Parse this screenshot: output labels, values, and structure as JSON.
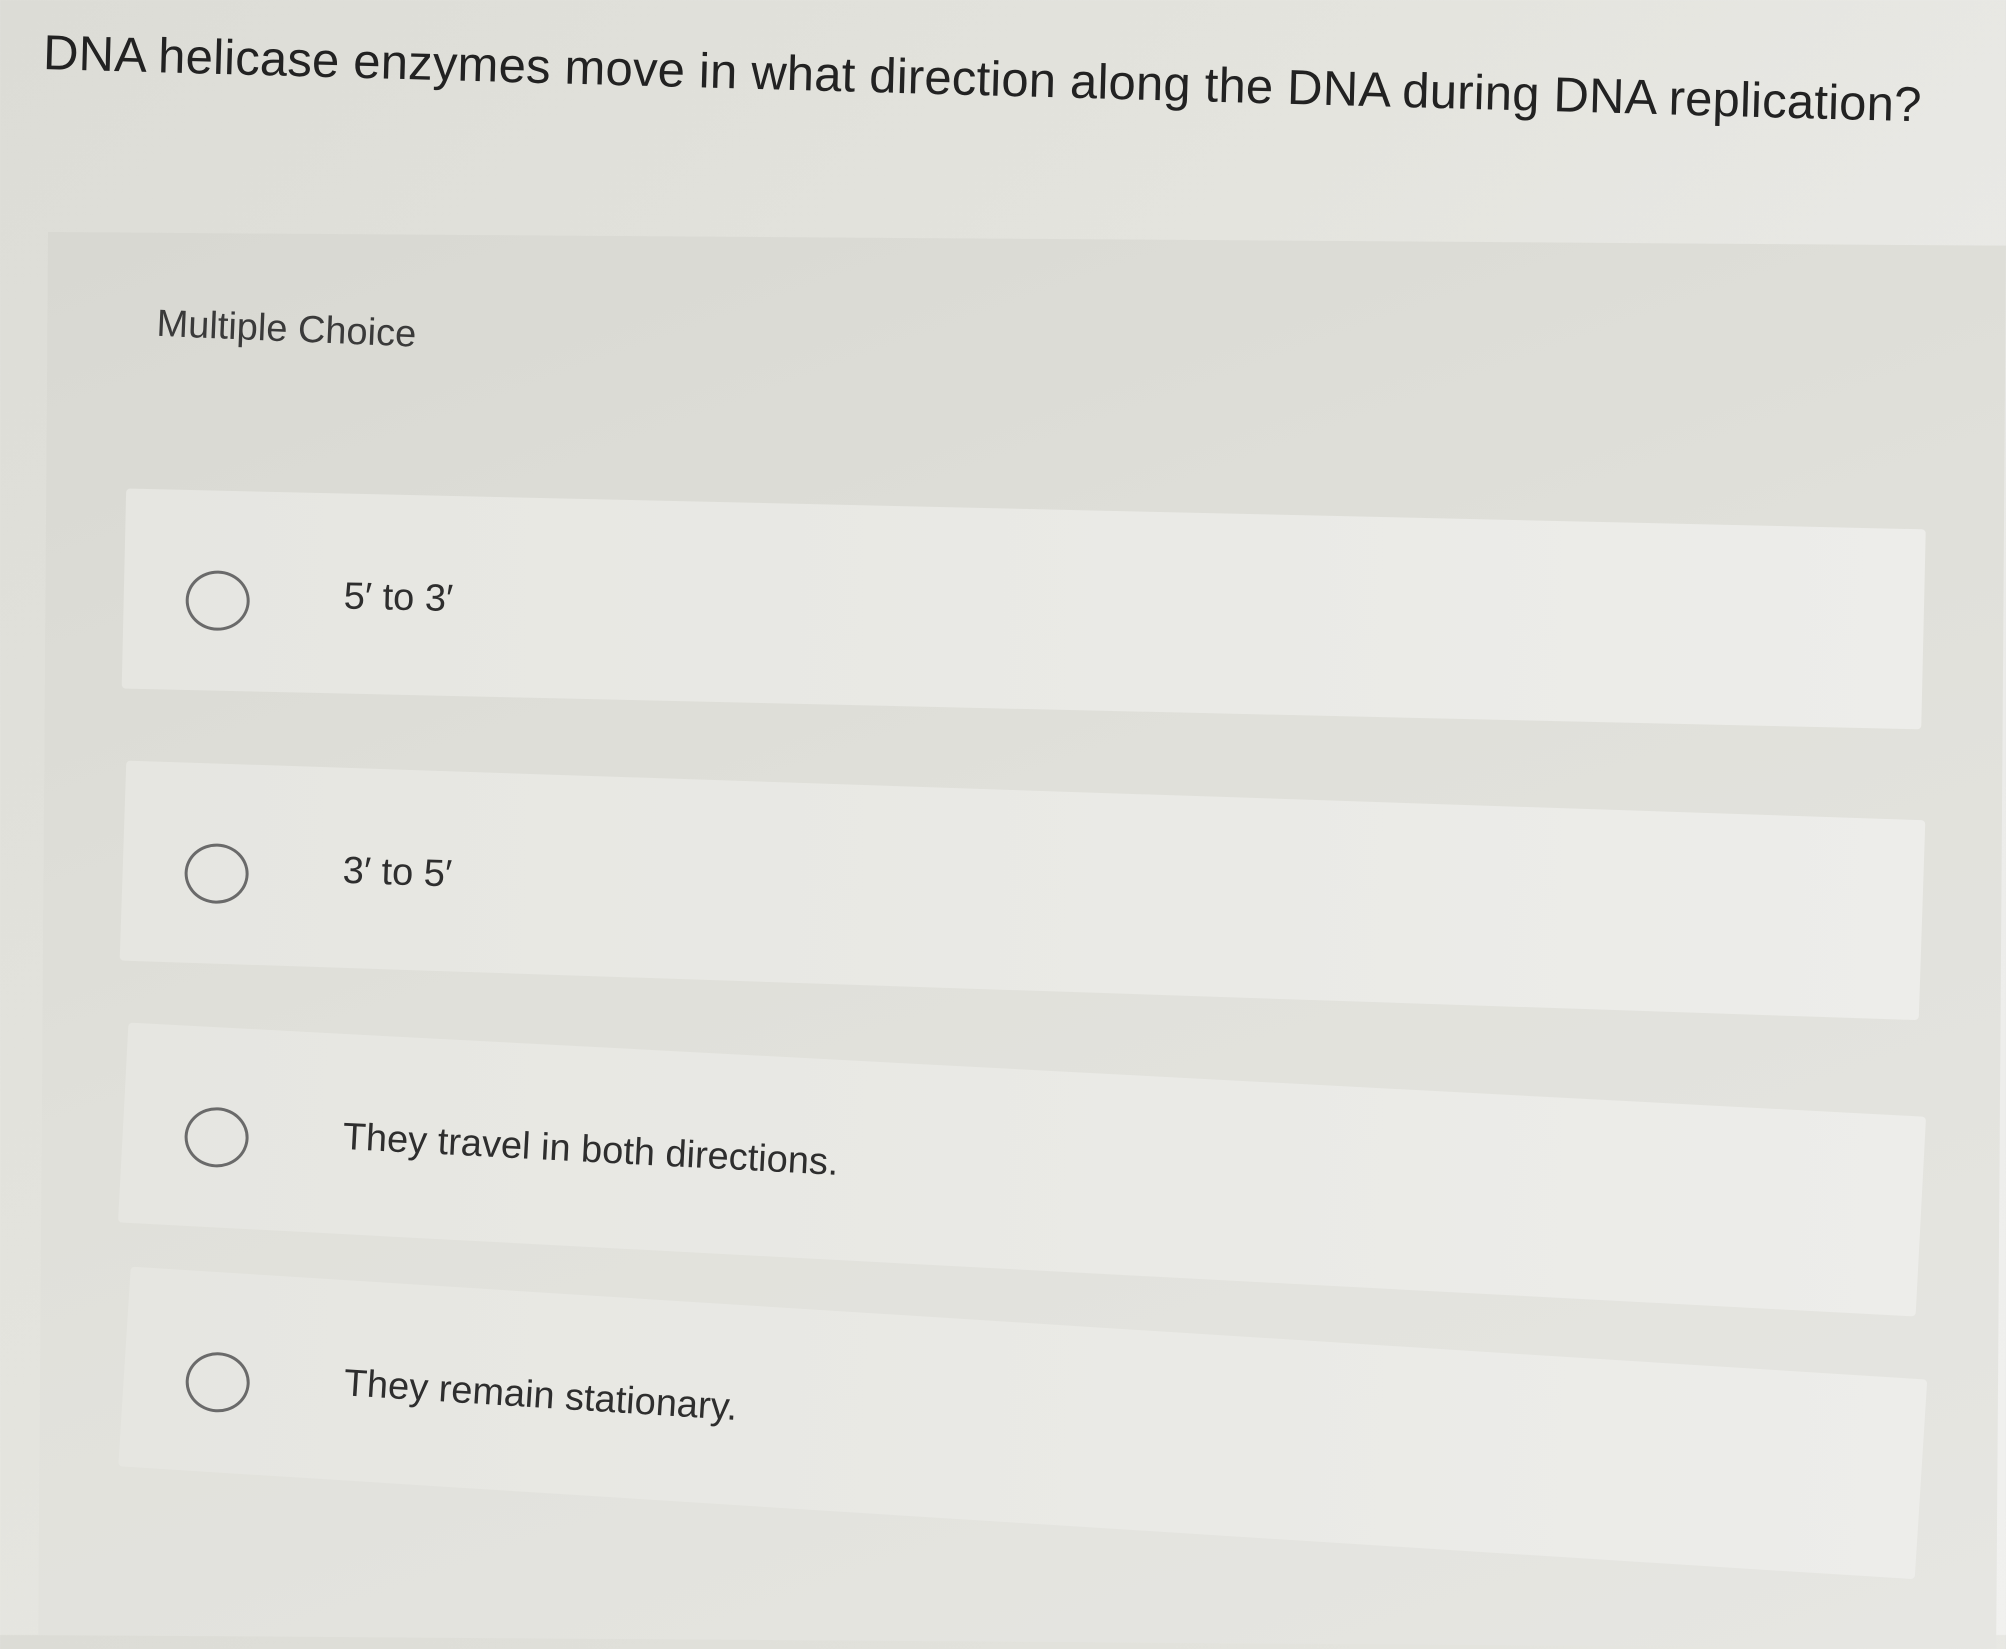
{
  "question": {
    "text": "DNA helicase enzymes move in what direction along the DNA during DNA replication?"
  },
  "quiz": {
    "type_label": "Multiple Choice",
    "options": [
      {
        "label": "5′ to 3′",
        "selected": false
      },
      {
        "label": "3′ to 5′",
        "selected": false
      },
      {
        "label": "They travel in both directions.",
        "selected": false
      },
      {
        "label": "They remain stationary.",
        "selected": false
      }
    ]
  },
  "icons": {
    "radio": "radio-button-unselected-icon"
  }
}
